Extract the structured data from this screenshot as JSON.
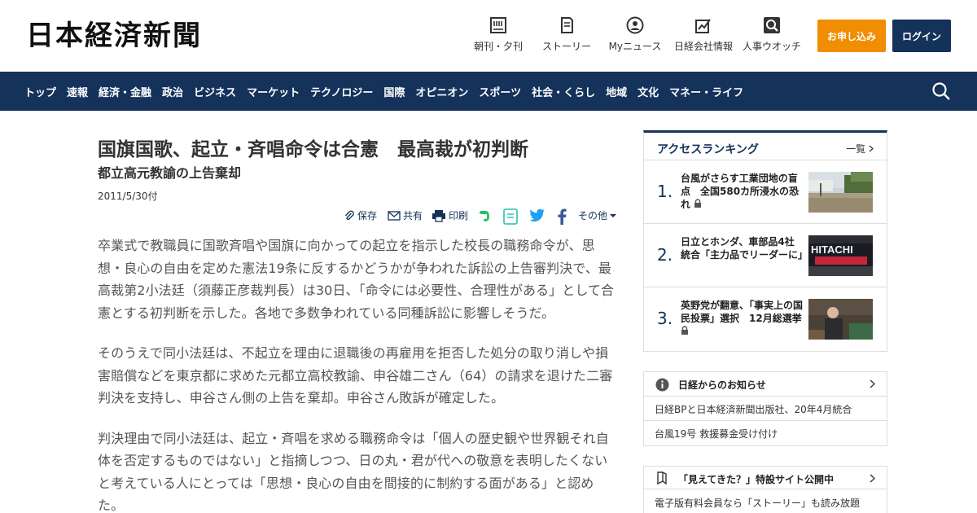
{
  "header": {
    "logo": "日本経済新聞",
    "nav": [
      {
        "label": "朝刊・夕刊",
        "icon": "newspaper-icon"
      },
      {
        "label": "ストーリー",
        "icon": "book-icon"
      },
      {
        "label": "Myニュース",
        "icon": "user-icon"
      },
      {
        "label": "日経会社情報",
        "icon": "chart-pen-icon"
      },
      {
        "label": "人事ウオッチ",
        "icon": "search-person-icon"
      }
    ],
    "apply_label": "お申し込み",
    "login_label": "ログイン"
  },
  "navbar": {
    "items": [
      "トップ",
      "速報",
      "経済・金融",
      "政治",
      "ビジネス",
      "マーケット",
      "テクノロジー",
      "国際",
      "オピニオン",
      "スポーツ",
      "社会・くらし",
      "地域",
      "文化",
      "マネー・ライフ"
    ]
  },
  "article": {
    "title": "国旗国歌、起立・斉唱命令は合憲　最高裁が初判断",
    "subtitle": "都立高元教諭の上告棄却",
    "date": "2011/5/30付",
    "tools": {
      "save": "保存",
      "share": "共有",
      "print": "印刷",
      "other": "その他"
    },
    "paragraphs": [
      "卒業式で教職員に国歌斉唱や国旗に向かっての起立を指示した校長の職務命令が、思想・良心の自由を定めた憲法19条に反するかどうかが争われた訴訟の上告審判決で、最高裁第2小法廷（須藤正彦裁判長）は30日、「命令には必要性、合理性がある」として合憲とする初判断を示した。各地で多数争われている同種訴訟に影響しそうだ。",
      "そのうえで同小法廷は、不起立を理由に退職後の再雇用を拒否した処分の取り消しや損害賠償などを東京都に求めた元都立高校教諭、申谷雄二さん（64）の請求を退けた二審判決を支持し、申谷さん側の上告を棄却。申谷さん敗訴が確定した。",
      "判決理由で同小法廷は、起立・斉唱を求める職務命令は「個人の歴史観や世界観それ自体を否定するものではない」と指摘しつつ、日の丸・君が代への敬意を表明したくないと考えている人にとっては「思想・良心の自由を間接的に制約する面がある」と認めた。"
    ]
  },
  "ranking": {
    "title": "アクセスランキング",
    "more": "一覧",
    "items": [
      {
        "num": "1.",
        "text": "台風がさらす工業団地の盲点　全国580カ所浸水の恐れ"
      },
      {
        "num": "2.",
        "text": "日立とホンダ、車部品4社統合「主力品でリーダーに」",
        "image_text": "HITACHI"
      },
      {
        "num": "3.",
        "text": "英野党が翻意、「事実上の国民投票」選択　12月総選挙"
      }
    ]
  },
  "notice": {
    "title": "日経からのお知らせ",
    "items": [
      "日経BPと日本経済新聞出版社、20年4月統合",
      "台風19号 救援募金受け付け"
    ]
  },
  "promo": {
    "title": "「見えてきた？」特設サイト公開中",
    "text": "電子版有料会員なら「ストーリー」も読み放題"
  },
  "colors": {
    "navy": "#14325a",
    "orange": "#f18d00"
  }
}
